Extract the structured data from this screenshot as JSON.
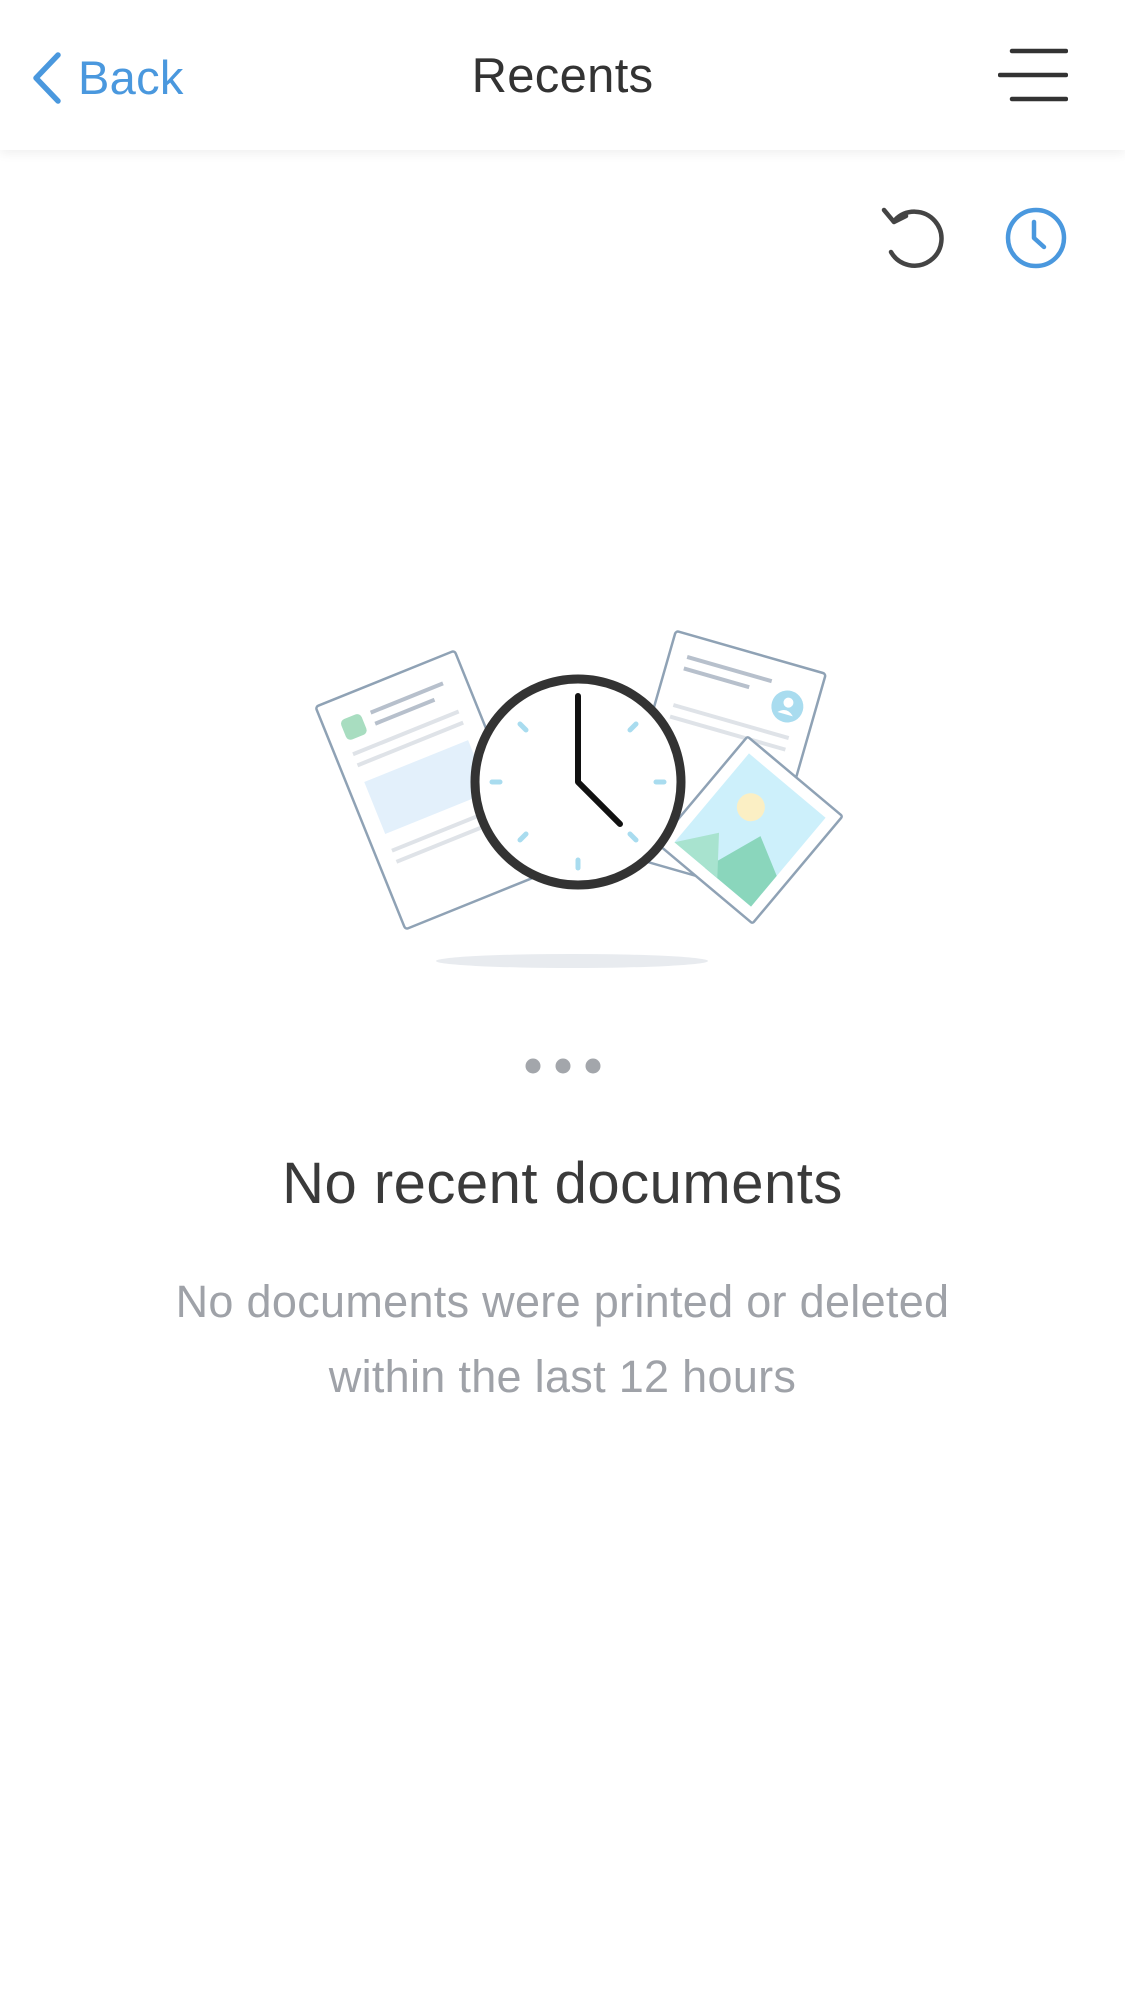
{
  "header": {
    "back_label": "Back",
    "title": "Recents",
    "menu_icon": "hamburger-menu-icon"
  },
  "toolbar": {
    "history_icon": "history-icon",
    "recents_icon": "clock-icon",
    "active_color": "#4a98de",
    "inactive_color": "#444444"
  },
  "empty_state": {
    "illustration": "clock-with-documents-illustration",
    "title": "No recent documents",
    "description_line1": "No documents were printed or deleted",
    "description_line2": "within the last 12 hours"
  },
  "colors": {
    "accent": "#4a98de",
    "title_text": "#333333",
    "muted_text": "#9fa2a8"
  }
}
